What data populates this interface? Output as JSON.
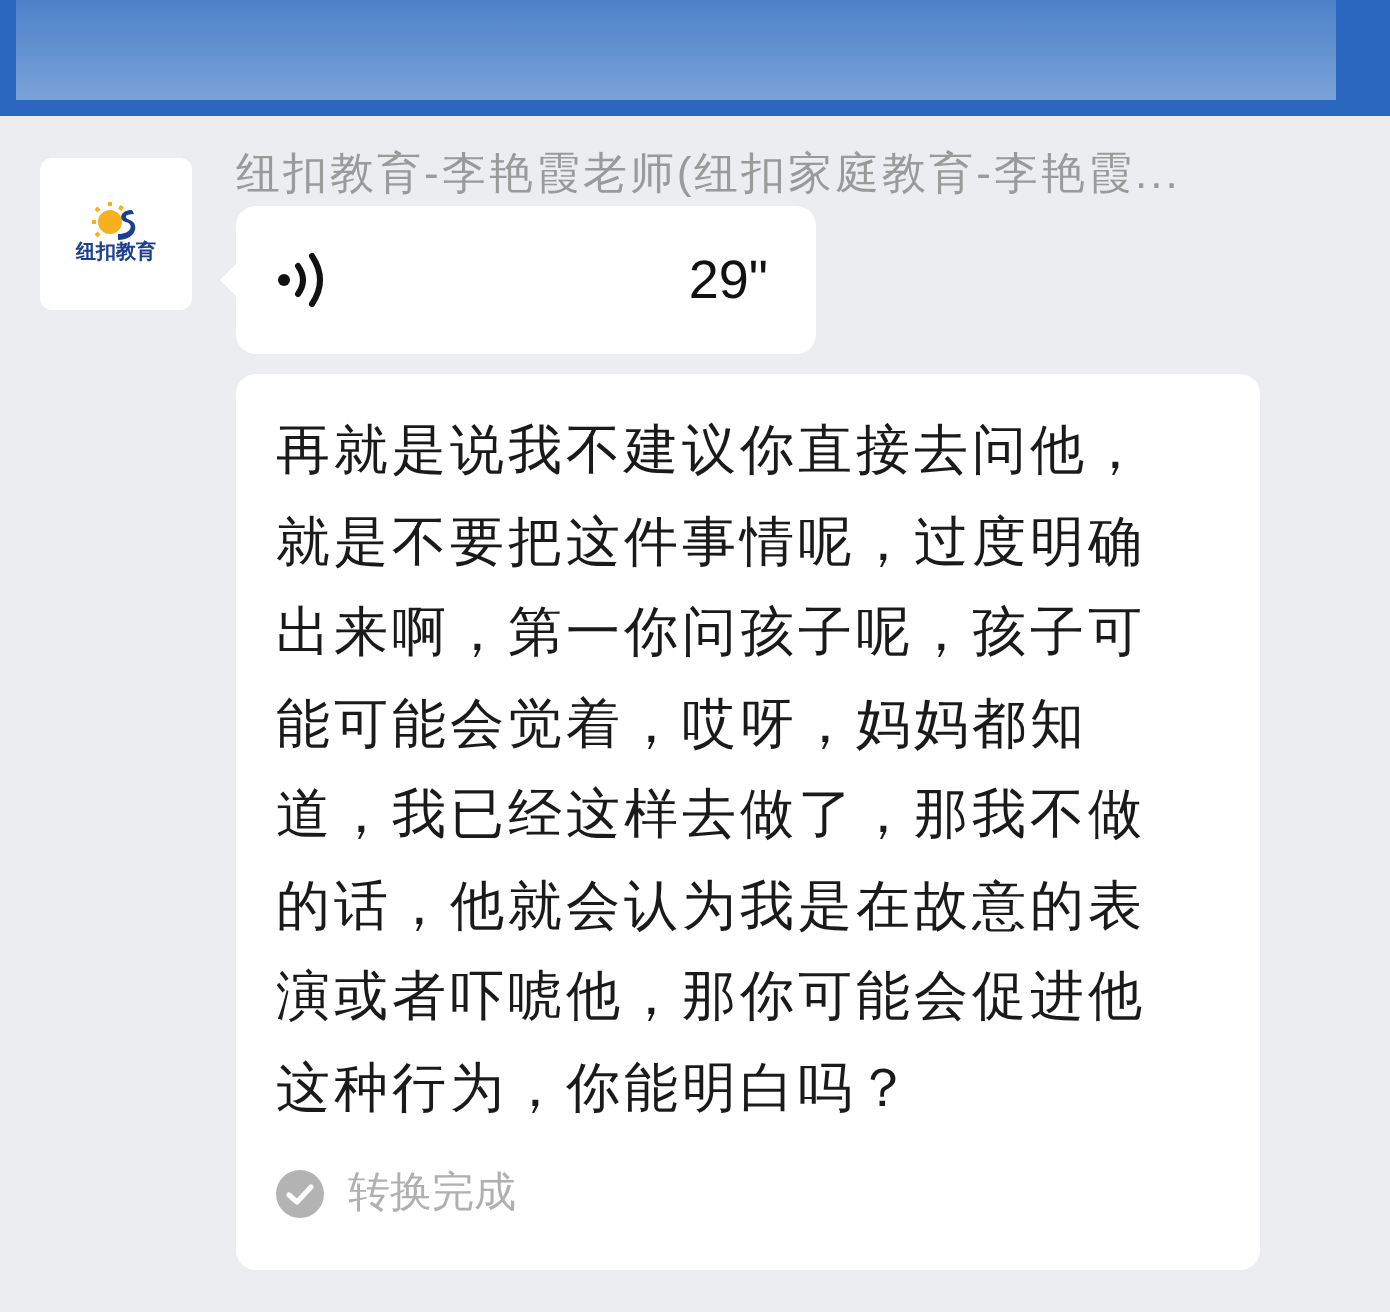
{
  "sender": {
    "name": "纽扣教育-李艳霞老师(纽扣家庭教育-李艳霞...",
    "avatar_text": "纽扣教育"
  },
  "messages": [
    {
      "kind": "voice",
      "duration": "29\""
    },
    {
      "kind": "text",
      "text": "再就是说我不建议你直接去问他，就是不要把这件事情呢，过度明确出来啊，第一你问孩子呢，孩子可能可能会觉着，哎呀，妈妈都知道，我已经这样去做了，那我不做的话，他就会认为我是在故意的表演或者吓唬他，那你可能会促进他这种行为，你能明白吗？",
      "status": "转换完成"
    }
  ]
}
